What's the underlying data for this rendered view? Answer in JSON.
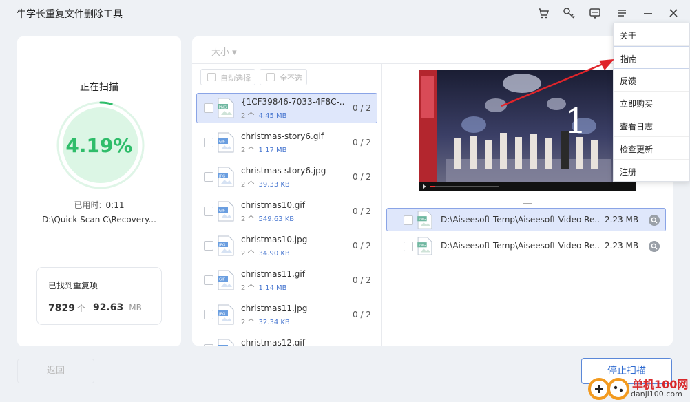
{
  "app": {
    "title": "牛学长重复文件删除工具"
  },
  "titlebar_icons": [
    "cart-icon",
    "key-icon",
    "feedback-icon",
    "menu-icon",
    "minimize-icon",
    "close-icon"
  ],
  "status": {
    "heading": "正在扫描",
    "progress_percent": 4.19,
    "progress_text": "4.19%",
    "elapsed_label": "已用时:",
    "elapsed_value": "0:11",
    "scan_path": "D:\\Quick Scan C\\Recovery...",
    "found_title": "已找到重复项",
    "found_count": "7829",
    "found_count_unit": "个",
    "found_size": "92.63",
    "found_size_unit": "MB"
  },
  "toolbar": {
    "sort_label": "大小 ▾",
    "auto_select_label": "自动选择",
    "deselect_all_label": "全不选"
  },
  "files": [
    {
      "name": "{1CF39846-7033-4F8C-...",
      "type": "PNG",
      "count": "2 个",
      "size": "4.45 MB",
      "ratio": "0 / 2",
      "selected": true
    },
    {
      "name": "christmas-story6.gif",
      "type": "GIF",
      "count": "2 个",
      "size": "1.17 MB",
      "ratio": "0 / 2",
      "selected": false
    },
    {
      "name": "christmas-story6.jpg",
      "type": "JPG",
      "count": "2 个",
      "size": "39.33 KB",
      "ratio": "0 / 2",
      "selected": false
    },
    {
      "name": "christmas10.gif",
      "type": "GIF",
      "count": "2 个",
      "size": "549.63 KB",
      "ratio": "0 / 2",
      "selected": false
    },
    {
      "name": "christmas10.jpg",
      "type": "JPG",
      "count": "2 个",
      "size": "34.90 KB",
      "ratio": "0 / 2",
      "selected": false
    },
    {
      "name": "christmas11.gif",
      "type": "GIF",
      "count": "2 个",
      "size": "1.14 MB",
      "ratio": "0 / 2",
      "selected": false
    },
    {
      "name": "christmas11.jpg",
      "type": "JPG",
      "count": "2 个",
      "size": "32.34 KB",
      "ratio": "0 / 2",
      "selected": false
    },
    {
      "name": "christmas12.gif",
      "type": "GIF",
      "count": "",
      "size": "",
      "ratio": "",
      "selected": false
    }
  ],
  "preview": {
    "overlay_number": "1"
  },
  "duplicates": [
    {
      "path": "D:\\Aiseesoft Temp\\Aiseesoft Video Re...",
      "type": "PNG",
      "size": "2.23 MB",
      "selected": true
    },
    {
      "path": "D:\\Aiseesoft Temp\\Aiseesoft Video Re...",
      "type": "PNG",
      "size": "2.23 MB",
      "selected": false
    }
  ],
  "buttons": {
    "back_label": "返回",
    "stop_label": "停止扫描"
  },
  "menu": {
    "items": [
      "关于",
      "指南",
      "反馈",
      "立即购买",
      "查看日志",
      "检查更新",
      "注册"
    ],
    "highlighted_index": 1
  },
  "watermark": {
    "text": "单机100网",
    "url": "danji100.com"
  },
  "colors": {
    "accent_green": "#2fbd6a",
    "accent_blue": "#2f6bd0",
    "arrow_red": "#e0242a",
    "selection_bg": "#dfe7fb"
  }
}
